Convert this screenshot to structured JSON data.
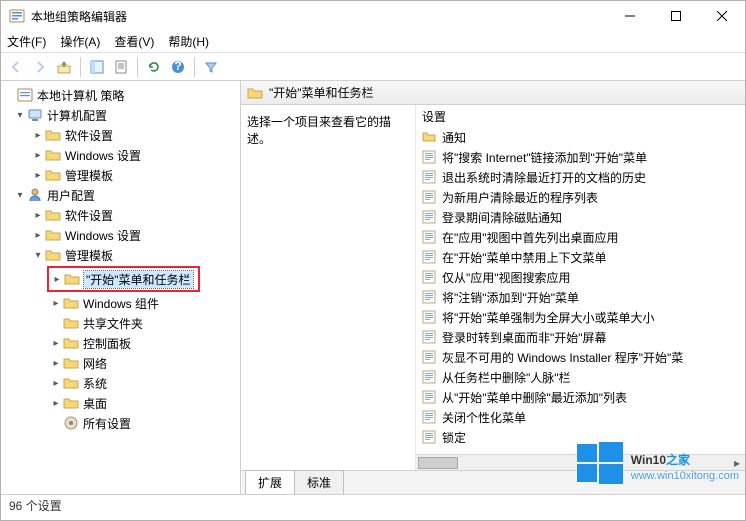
{
  "window": {
    "title": "本地组策略编辑器"
  },
  "menu": {
    "file": "文件(F)",
    "action": "操作(A)",
    "view": "查看(V)",
    "help": "帮助(H)"
  },
  "tree": {
    "root": "本地计算机 策略",
    "computer": "计算机配置",
    "user": "用户配置",
    "sw": "软件设置",
    "win": "Windows 设置",
    "admin": "管理模板",
    "start_taskbar": "\"开始\"菜单和任务栏",
    "win_components": "Windows 组件",
    "shared": "共享文件夹",
    "ctrl": "控制面板",
    "network": "网络",
    "system": "系统",
    "desktop": "桌面",
    "all": "所有设置"
  },
  "detail": {
    "header_title": "\"开始\"菜单和任务栏",
    "prompt": "选择一个项目来查看它的描述。",
    "col_setting": "设置",
    "folder_notify": "通知",
    "items": [
      "将\"搜索 Internet\"链接添加到\"开始\"菜单",
      "退出系统时清除最近打开的文档的历史",
      "为新用户清除最近的程序列表",
      "登录期间清除磁贴通知",
      "在\"应用\"视图中首先列出桌面应用",
      "在\"开始\"菜单中禁用上下文菜单",
      "仅从\"应用\"视图搜索应用",
      "将\"注销\"添加到\"开始\"菜单",
      "将\"开始\"菜单强制为全屏大小或菜单大小",
      "登录时转到桌面而非\"开始\"屏幕",
      "灰显不可用的 Windows Installer 程序\"开始\"菜",
      "从任务栏中删除\"人脉\"栏",
      "从\"开始\"菜单中删除\"最近添加\"列表",
      "关闭个性化菜单",
      "锁定"
    ]
  },
  "tabs": {
    "extended": "扩展",
    "standard": "标准"
  },
  "status": {
    "text": "96 个设置"
  },
  "watermark": {
    "brand": "Win10",
    "suffix": "之家",
    "url": "www.win10xitong.com"
  }
}
